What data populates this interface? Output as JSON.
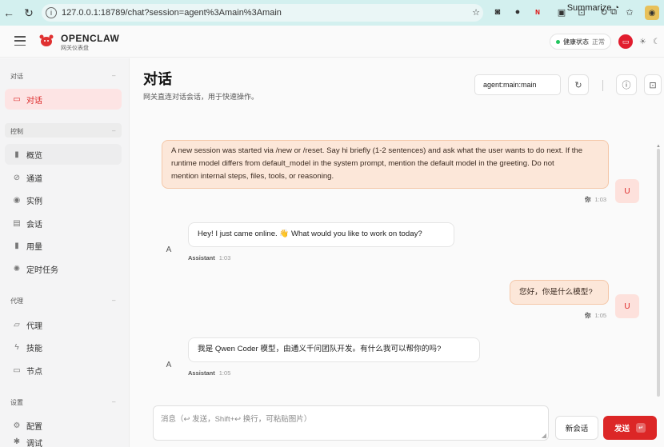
{
  "browser": {
    "url": "127.0.0.1:18789/chat?session=agent%3Amain%3Amain",
    "summarize_label": "Summarize"
  },
  "header": {
    "brand_name": "OPENCLAW",
    "brand_subtitle": "网关仪表盘",
    "health_label": "健康状态",
    "health_status": "正常"
  },
  "sidebar": {
    "sections": [
      {
        "title": "对话",
        "items": [
          {
            "label": "对话",
            "icon": "chat-icon",
            "active": true
          }
        ]
      },
      {
        "title": "控制",
        "items": [
          {
            "label": "概览",
            "icon": "bar-chart-icon"
          },
          {
            "label": "通道",
            "icon": "link-icon"
          },
          {
            "label": "实例",
            "icon": "broadcast-icon"
          },
          {
            "label": "会话",
            "icon": "document-icon"
          },
          {
            "label": "用量",
            "icon": "usage-icon"
          },
          {
            "label": "定时任务",
            "icon": "loader-icon"
          }
        ]
      },
      {
        "title": "代理",
        "items": [
          {
            "label": "代理",
            "icon": "folder-icon"
          },
          {
            "label": "技能",
            "icon": "bolt-icon"
          },
          {
            "label": "节点",
            "icon": "monitor-icon"
          }
        ]
      },
      {
        "title": "设置",
        "items": [
          {
            "label": "配置",
            "icon": "gear-icon"
          },
          {
            "label": "调试",
            "icon": "bug-icon"
          }
        ]
      }
    ]
  },
  "main": {
    "title": "对话",
    "subtitle": "网关直连对话会话，用于快速操作。",
    "session_value": "agent:main:main"
  },
  "messages": [
    {
      "role": "user",
      "avatar": "U",
      "lines": [
        "A new session was started via /new or /reset. Say hi briefly (1-2 sentences) and ask what the user wants to do next. If the",
        "runtime model differs from default_model in the system prompt, mention the default model in the greeting. Do not",
        "mention internal steps, files, tools, or reasoning."
      ],
      "sender": "你",
      "time": "1:03"
    },
    {
      "role": "assistant",
      "avatar": "A",
      "text": "Hey! I just came online. 👋 What would you like to work on today?",
      "sender": "Assistant",
      "time": "1:03"
    },
    {
      "role": "user",
      "avatar": "U",
      "text": "您好，你是什么模型?",
      "sender": "你",
      "time": "1:05"
    },
    {
      "role": "assistant",
      "avatar": "A",
      "text": "我是 Qwen Coder 模型，由通义千问团队开发。有什么我可以帮你的吗?",
      "sender": "Assistant",
      "time": "1:05"
    }
  ],
  "composer": {
    "placeholder": "消息（↩ 发送，Shift+↩ 换行，可粘贴图片）",
    "new_chat_label": "新会话",
    "send_label": "发送",
    "send_kbd": "↵"
  },
  "colors": {
    "accent": "#dc2626",
    "user_bubble": "#fce7d9",
    "active_nav_bg": "#fde4e4",
    "chrome_bg": "#d3f0ef"
  }
}
